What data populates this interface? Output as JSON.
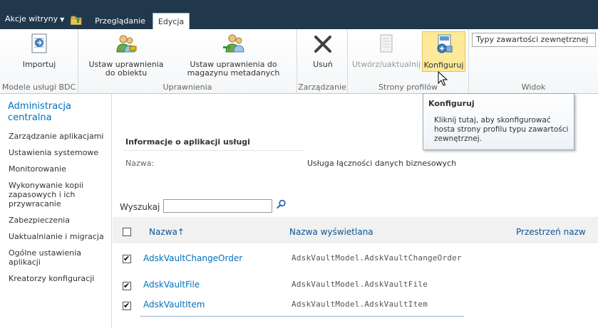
{
  "topbar": {
    "site_actions": "Akcje witryny",
    "tabs": [
      {
        "label": "Przeglądanie"
      },
      {
        "label": "Edycja"
      }
    ]
  },
  "ribbon": {
    "groups": [
      {
        "label": "Modele usługi BDC",
        "buttons": [
          {
            "label": "Importuj",
            "icon": "import-icon"
          }
        ]
      },
      {
        "label": "Uprawnienia",
        "buttons": [
          {
            "label": "Ustaw uprawnienia do obiektu",
            "icon": "object-permissions-icon"
          },
          {
            "label": "Ustaw uprawnienia do magazynu metadanych",
            "icon": "metadata-store-permissions-icon"
          }
        ]
      },
      {
        "label": "Zarządzanie",
        "buttons": [
          {
            "label": "Usuń",
            "icon": "delete-icon"
          }
        ]
      },
      {
        "label": "Strony profilów",
        "buttons": [
          {
            "label": "Utwórz/uaktualnij",
            "icon": "create-upgrade-icon"
          },
          {
            "label": "Konfiguruj",
            "icon": "configure-icon"
          }
        ]
      },
      {
        "label": "Widok",
        "dropdown_value": "Typy zawartości zewnętrznej"
      }
    ]
  },
  "leftnav": {
    "title": "Administracja centralna",
    "items": [
      "Zarządzanie aplikacjami",
      "Ustawienia systemowe",
      "Monitorowanie",
      "Wykonywanie kopii zapasowych i ich przywracanie",
      "Zabezpieczenia",
      "Uaktualnianie i migracja",
      "Ogólne ustawienia aplikacji",
      "Kreatorzy konfiguracji"
    ]
  },
  "tooltip": {
    "title": "Konfiguruj",
    "body": "Kliknij tutaj, aby skonfigurować hosta strony profilu typu zawartości zewnętrznej."
  },
  "main": {
    "section_title": "Informacje o aplikacji usługi",
    "name_label": "Nazwa:",
    "name_value": "Usługa łączności danych biznesowych",
    "search_label": "Wyszukaj",
    "columns": [
      "Nazwa↑",
      "Nazwa wyświetlana",
      "Przestrzeń nazw"
    ],
    "rows": [
      {
        "name": "AdskVaultChangeOrder",
        "display": "AdskVaultModel.AdskVaultChangeOrder",
        "checked": true
      },
      {
        "name": "AdskVaultFile",
        "display": "AdskVaultModel.AdskVaultFile",
        "checked": true
      },
      {
        "name": "AdskVaultItem",
        "display": "AdskVaultModel.AdskVaultItem",
        "checked": true
      }
    ]
  }
}
